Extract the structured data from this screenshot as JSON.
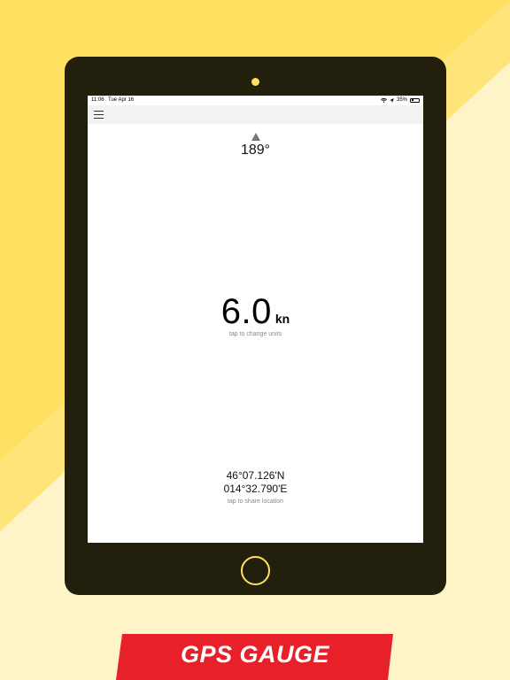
{
  "status_bar": {
    "time": "11:06",
    "date": "Tue Apr 16",
    "battery_text": "35%",
    "battery_level": 0.35,
    "wifi_icon": "wifi-icon",
    "location_icon": "location-arrow-icon"
  },
  "nav": {
    "menu_icon": "hamburger-menu-icon"
  },
  "heading": {
    "value": "189°"
  },
  "speed": {
    "value": "6.0",
    "unit": "kn",
    "hint": "tap to change units"
  },
  "location": {
    "latitude": "46°07.126'N",
    "longitude": "014°32.790'E",
    "hint": "tap to share location"
  },
  "banner": {
    "title": "GPS GAUGE",
    "color": "#e8202a"
  },
  "colors": {
    "background": "#ffe060",
    "background_light": "#fff4c8",
    "tablet": "#231f0d",
    "accent": "#ffe060"
  }
}
